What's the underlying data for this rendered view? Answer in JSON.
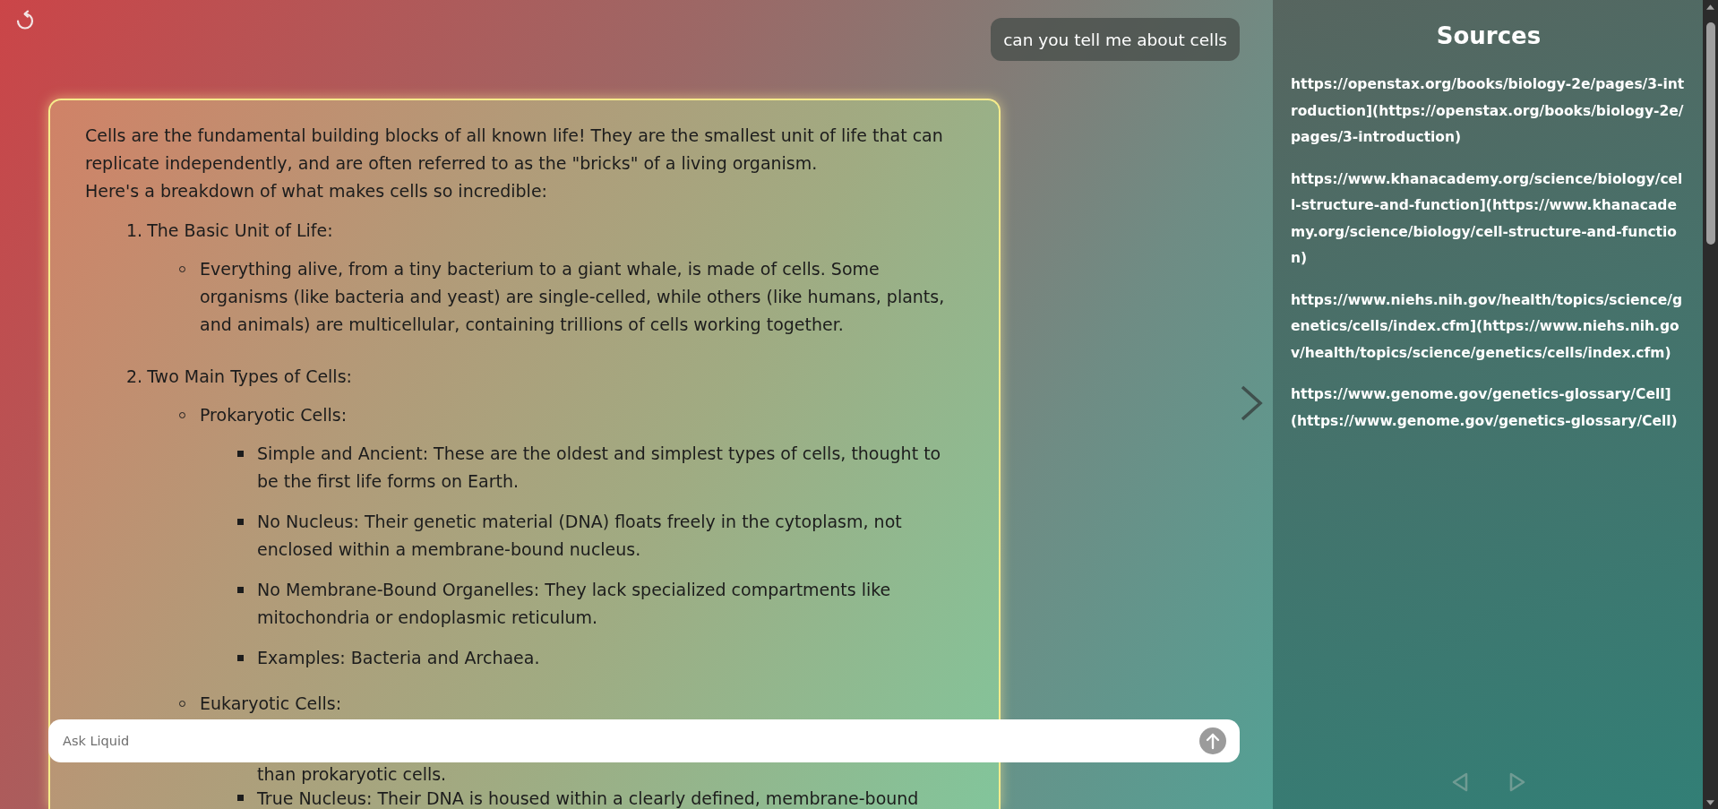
{
  "chat": {
    "user_message": "can you tell me about cells",
    "reply": {
      "paragraphs": [
        "Cells are the fundamental building blocks of all known life! They are the smallest unit of life that can replicate independently, and are often referred to as the \"bricks\" of a living organism.",
        "Here's a breakdown of what makes cells so incredible:"
      ],
      "sections": [
        {
          "number": "1.",
          "title": "The Basic Unit of Life:",
          "items": [
            {
              "kind": "point",
              "text": "Everything alive, from a tiny bacterium to a giant whale, is made of cells. Some organisms (like bacteria and yeast) are single-celled, while others (like humans, plants, and animals) are multicellular, containing trillions of cells working together."
            }
          ]
        },
        {
          "number": "2.",
          "title": "Two Main Types of Cells:",
          "items": [
            {
              "kind": "point",
              "text": "Prokaryotic Cells:",
              "children": [
                {
                  "kind": "point",
                  "text": "Simple and Ancient: These are the oldest and simplest types of cells, thought to be the first life forms on Earth."
                },
                {
                  "kind": "point",
                  "text": "No Nucleus: Their genetic material (DNA) floats freely in the cytoplasm, not enclosed within a membrane-bound nucleus."
                },
                {
                  "kind": "point",
                  "text": "No Membrane-Bound Organelles: They lack specialized compartments like mitochondria or endoplasmic reticulum."
                },
                {
                  "kind": "point",
                  "text": "Examples: Bacteria and Archaea."
                }
              ]
            },
            {
              "kind": "point",
              "text": "Eukaryotic Cells:",
              "children": [
                {
                  "kind": "continued",
                  "text": "than prokaryotic cells."
                },
                {
                  "kind": "point",
                  "text": "True Nucleus: Their DNA is housed within a clearly defined, membrane-bound"
                }
              ]
            }
          ]
        }
      ]
    },
    "input": {
      "placeholder": "Ask Liquid"
    }
  },
  "sources": {
    "title": "Sources",
    "urls": [
      "https://openstax.org/books/biology-2e/pages/3-introduction](https://openstax.org/books/biology-2e/pages/3-introduction)",
      "https://www.khanacademy.org/science/biology/cell-structure-and-function](https://www.khanacademy.org/science/biology/cell-structure-and-function)",
      "https://www.niehs.nih.gov/health/topics/science/genetics/cells/index.cfm](https://www.niehs.nih.gov/health/topics/science/genetics/cells/index.cfm)",
      "https://www.genome.gov/genetics-glossary/Cell](https://www.genome.gov/genetics-glossary/Cell)"
    ],
    "pager": [
      {
        "kind": "prev",
        "disabled": true
      },
      {
        "kind": "next",
        "disabled": true
      }
    ]
  }
}
